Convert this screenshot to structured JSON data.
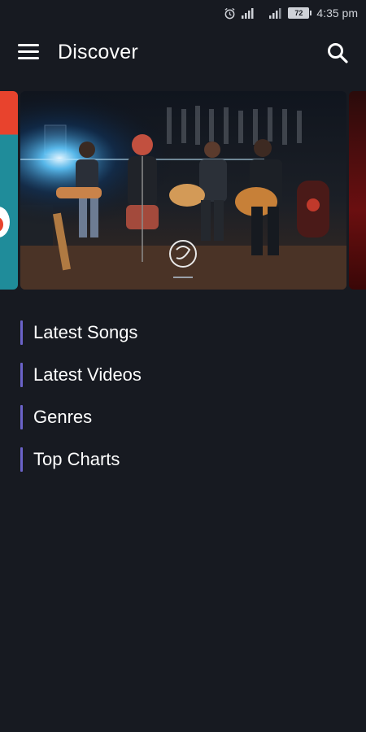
{
  "status_bar": {
    "battery": "72",
    "time": "4:35 pm",
    "icons": [
      "alarm-icon",
      "signal-icon",
      "signal-icon",
      "battery-icon"
    ]
  },
  "header": {
    "title": "Discover",
    "menu_icon": "hamburger-menu-icon",
    "search_icon": "search-icon"
  },
  "carousel": {
    "slides": [
      "prev-slide",
      "featured-band-slide",
      "next-slide"
    ]
  },
  "menu": {
    "items": [
      {
        "label": "Latest Songs"
      },
      {
        "label": "Latest Videos"
      },
      {
        "label": "Genres"
      },
      {
        "label": "Top Charts"
      }
    ]
  },
  "colors": {
    "background": "#171a21",
    "accent": "#6b63c9",
    "text": "#ffffff"
  }
}
